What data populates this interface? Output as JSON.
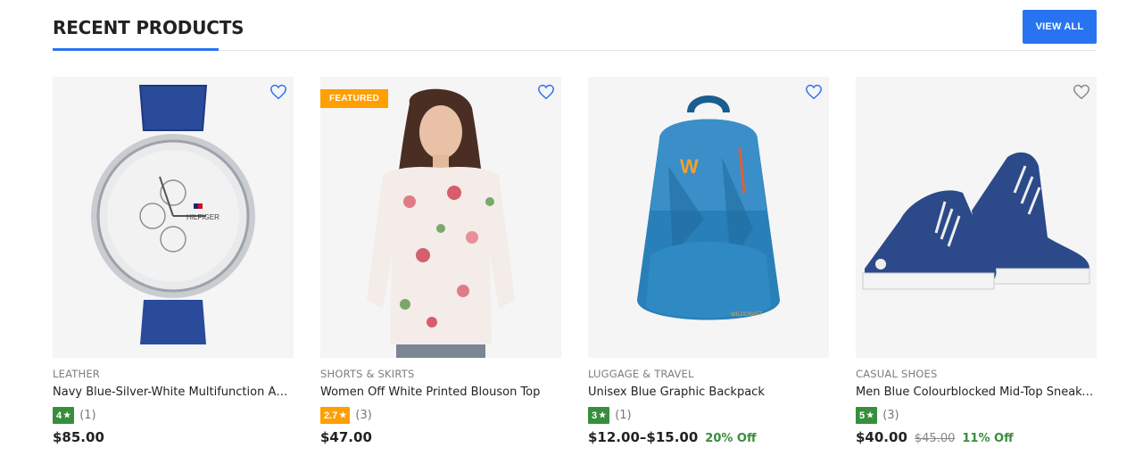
{
  "section": {
    "title": "RECENT PRODUCTS",
    "view_all_label": "VIEW ALL"
  },
  "colors": {
    "accent": "#2874f0",
    "rating_green": "#388e3c",
    "rating_orange": "#ff9f00",
    "discount_green": "#388e3c"
  },
  "products": [
    {
      "category": "LEATHER",
      "name": "Navy Blue-Silver-White Multifunction Analog Watch",
      "rating": "4",
      "rating_count": "(1)",
      "price": "$85.00",
      "old_price": "",
      "discount": "",
      "badge": "",
      "image_icon": "watch-image",
      "wishlist_icon": "heart-outline-icon"
    },
    {
      "category": "SHORTS & SKIRTS",
      "name": "Women Off White Printed Blouson Top",
      "rating": "2.7",
      "rating_count": "(3)",
      "price": "$47.00",
      "old_price": "",
      "discount": "",
      "badge": "FEATURED",
      "image_icon": "floral-top-image",
      "wishlist_icon": "heart-outline-icon"
    },
    {
      "category": "LUGGAGE & TRAVEL",
      "name": "Unisex Blue Graphic Backpack",
      "rating": "3",
      "rating_count": "(1)",
      "price": "$12.00–$15.00",
      "old_price": "",
      "discount": "20% Off",
      "badge": "",
      "image_icon": "backpack-image",
      "wishlist_icon": "heart-outline-icon"
    },
    {
      "category": "CASUAL SHOES",
      "name": "Men Blue Colourblocked Mid-Top Sneakers",
      "rating": "5",
      "rating_count": "(3)",
      "price": "$40.00",
      "old_price": "$45.00",
      "discount": "11% Off",
      "badge": "",
      "image_icon": "sneakers-image",
      "wishlist_icon": "heart-outline-icon"
    }
  ]
}
